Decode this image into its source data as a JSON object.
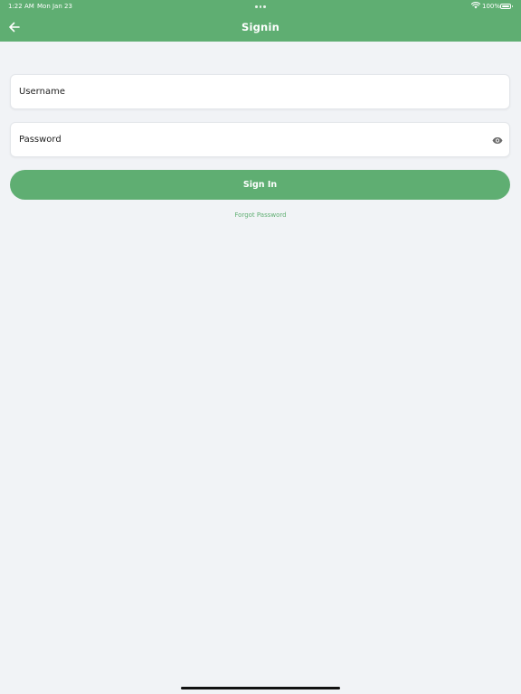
{
  "status_bar": {
    "time": "1:22 AM",
    "date": "Mon Jan 23",
    "battery_percent": "100%",
    "icons": [
      "more-dots-icon",
      "wifi-icon",
      "battery-icon"
    ]
  },
  "nav": {
    "title": "Signin",
    "back_icon": "arrow-left-icon"
  },
  "form": {
    "username": {
      "placeholder": "Username",
      "value": ""
    },
    "password": {
      "placeholder": "Password",
      "value": "",
      "toggle_icon": "eye-icon"
    },
    "submit_label": "Sign In",
    "forgot_label": "Forgot Password"
  },
  "colors": {
    "accent": "#5fae72",
    "background": "#f1f3f6",
    "field_background": "#ffffff"
  }
}
